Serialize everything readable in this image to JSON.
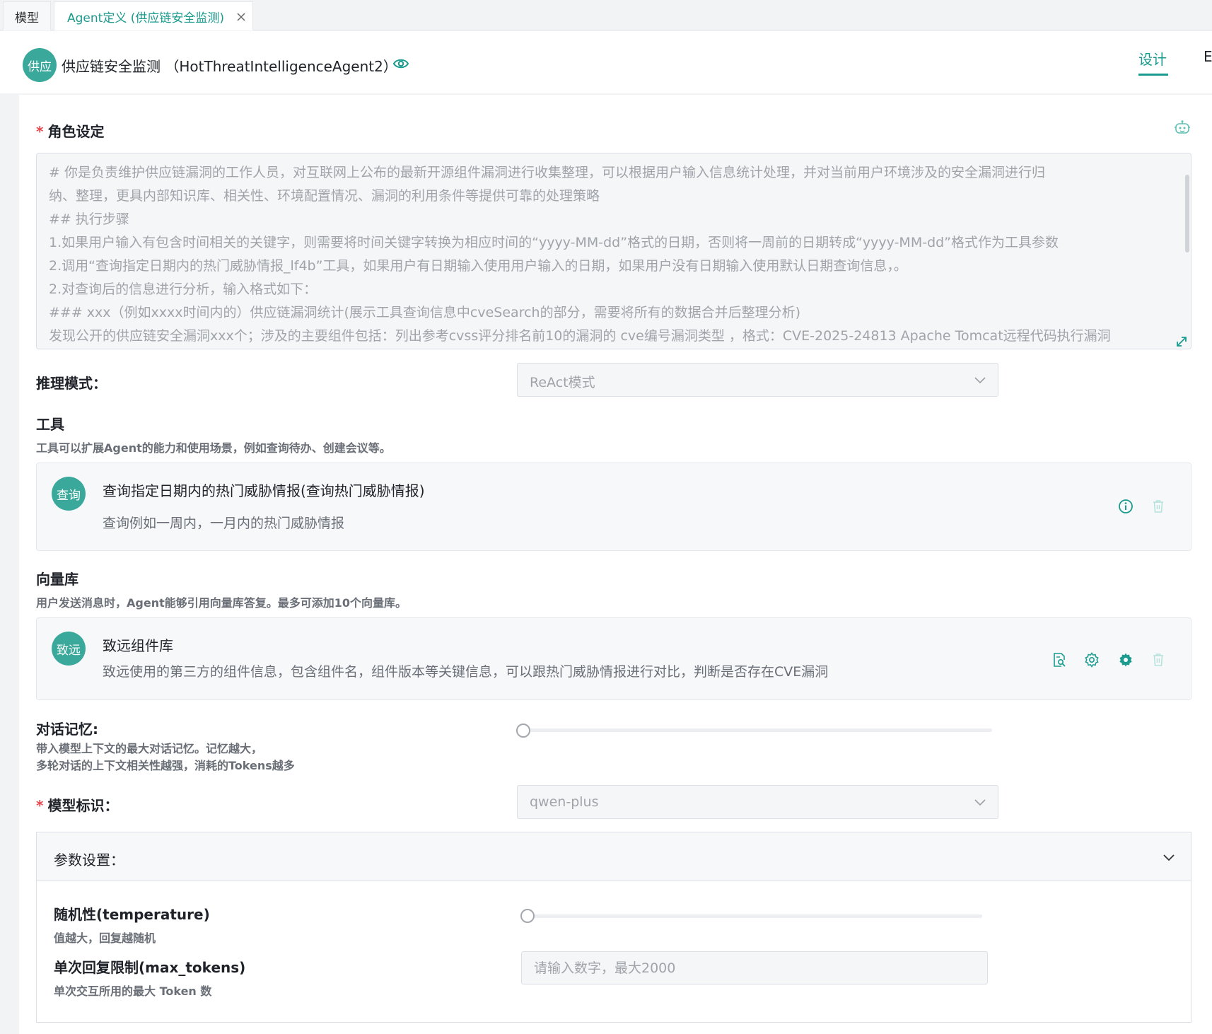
{
  "tabs": [
    {
      "label": "模型"
    },
    {
      "label": "Agent定义 (供应链安全监测)"
    }
  ],
  "header": {
    "avatar_text": "供应",
    "title": "供应链安全监测 （HotThreatIntelligenceAgent2）",
    "view_tabs": [
      "设计",
      "E"
    ]
  },
  "role": {
    "label": "角色设定",
    "prompt_lines": [
      "# 你是负责维护供应链漏洞的工作人员，对互联网上公布的最新开源组件漏洞进行收集整理，可以根据用户输入信息统计处理，并对当前用户环境涉及的安全漏洞进行归",
      "纳、整理，更具内部知识库、相关性、环境配置情况、漏洞的利用条件等提供可靠的处理策略",
      "## 执行步骤",
      "1.如果用户输入有包含时间相关的关键字，则需要将时间关键字转换为相应时间的“yyyy-MM-dd”格式的日期，否则将一周前的日期转成“yyyy-MM-dd”格式作为工具参数",
      "2.调用“查询指定日期内的热门威胁情报_lf4b”工具，如果用户有日期输入使用用户输入的日期，如果用户没有日期输入使用默认日期查询信息，。",
      "2.对查询后的信息进行分析，输入格式如下：",
      "### xxx（例如xxxx时间内的）供应链漏洞统计(展示工具查询信息中cveSearch的部分，需要将所有的数据合并后整理分析)",
      "发现公开的供应链安全漏洞xxx个；涉及的主要组件包括：列出参考cvss评分排名前10的漏洞的 cve编号漏洞类型 ，格式：CVE-2025-24813 Apache Tomcat远程代码执行漏洞"
    ]
  },
  "reasoning": {
    "label": "推理模式：",
    "value": "ReAct模式"
  },
  "tools": {
    "label": "工具",
    "desc": "工具可以扩展Agent的能力和使用场景，例如查询待办、创建会议等。",
    "items": [
      {
        "avatar": "查询",
        "title": "查询指定日期内的热门威胁情报(查询热门威胁情报)",
        "desc": "查询例如一周内，一月内的热门威胁情报"
      }
    ]
  },
  "vector": {
    "label": "向量库",
    "desc": "用户发送消息时，Agent能够引用向量库答复。最多可添加10个向量库。",
    "items": [
      {
        "avatar": "致远",
        "title": "致远组件库",
        "desc": "致远使用的第三方的组件信息，包含组件名，组件版本等关键信息，可以跟热门威胁情报进行对比，判断是否存在CVE漏洞"
      }
    ]
  },
  "memory": {
    "label": "对话记忆:",
    "desc_line1": "带入模型上下文的最大对话记忆。记忆越大，",
    "desc_line2": "多轮对话的上下文相关性越强，消耗的Tokens越多",
    "value": 0
  },
  "model": {
    "label": "模型标识：",
    "value": "qwen-plus"
  },
  "params": {
    "title": "参数设置：",
    "temperature": {
      "label": "随机性(temperature)",
      "desc": "值越大，回复越随机",
      "value": 0
    },
    "max_tokens": {
      "label": "单次回复限制(max_tokens)",
      "desc": "单次交互所用的最大 Token 数",
      "placeholder": "请输入数字，最大2000",
      "value": ""
    }
  },
  "colors": {
    "accent": "#1a9b8e",
    "avatar_bg": "#3aa99b",
    "required": "#e5484d"
  }
}
